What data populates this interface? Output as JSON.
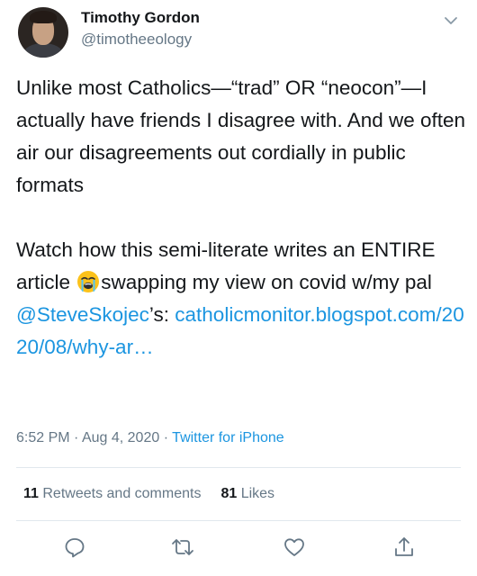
{
  "author": {
    "name": "Timothy Gordon",
    "handle": "@timotheeology"
  },
  "tweet": {
    "paragraph1": "Unlike most Catholics—“trad” OR “neocon”—I actually have friends I disagree with. And we often air our disagreements out cordially in public formats",
    "p2_before_emoji": "Watch how this semi-literate writes an ENTIRE article ",
    "emoji": "loudly-crying-face",
    "p2_after_emoji": "swapping my view on covid w/my pal ",
    "mention": "@SteveSkojec",
    "p2_after_mention": "’s: ",
    "link": "catholicmonitor.blogspot.com/2020/08/why-ar…"
  },
  "meta": {
    "time": "6:52 PM",
    "separator": "·",
    "date": "Aug 4, 2020",
    "source": "Twitter for iPhone"
  },
  "stats": {
    "retweets_count": "11",
    "retweets_label": "Retweets and comments",
    "likes_count": "81",
    "likes_label": "Likes"
  },
  "icons": [
    "chevron-down-icon",
    "reply-icon",
    "retweet-icon",
    "like-icon",
    "share-icon"
  ],
  "colors": {
    "link": "#1b95e0",
    "secondary_text": "#657786",
    "primary_text": "#14171a",
    "divider": "#e1e8ed"
  }
}
